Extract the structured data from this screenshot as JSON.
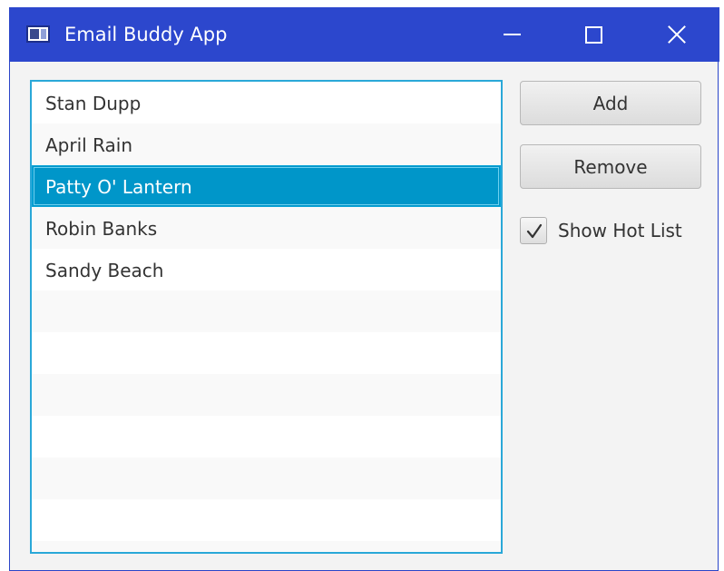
{
  "window": {
    "title": "Email Buddy App"
  },
  "list": {
    "items": [
      "Stan Dupp",
      "April Rain",
      "Patty O' Lantern",
      "Robin Banks",
      "Sandy Beach",
      "",
      "",
      "",
      "",
      "",
      "",
      ""
    ],
    "selected_index": 2
  },
  "buttons": {
    "add_label": "Add",
    "remove_label": "Remove"
  },
  "hot_list": {
    "label": "Show Hot List",
    "checked": true
  },
  "icons": {
    "app": "app-window-icon",
    "minimize": "minimize-icon",
    "maximize": "maximize-icon",
    "close": "close-icon",
    "check": "checkmark-icon"
  },
  "colors": {
    "titlebar": "#2c47cd",
    "selection": "#0096c9",
    "list_border": "#2aa8d8"
  }
}
